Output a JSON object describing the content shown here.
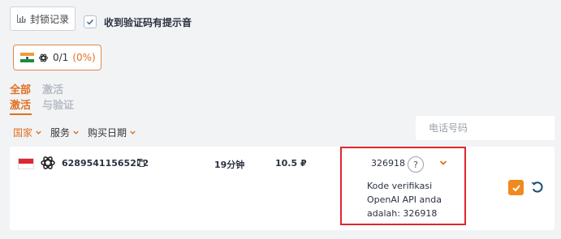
{
  "toolbar": {
    "block_records_label": "封锁记录",
    "notify_label": "收到验证码有提示音",
    "notify_checked": true
  },
  "country_pill": {
    "count": "0/1",
    "percent": "(0%)"
  },
  "tabs": [
    {
      "line1": "全部",
      "line2": "激活",
      "active": true
    },
    {
      "line1": "激活",
      "line2": "与验证",
      "active": false
    }
  ],
  "filters": [
    {
      "label": "国家",
      "active": true
    },
    {
      "label": "服务",
      "active": false
    },
    {
      "label": "购买日期",
      "active": false
    }
  ],
  "search": {
    "placeholder": "电话号码",
    "value": ""
  },
  "order": {
    "phone": "62895411565222",
    "duration": "19分钟",
    "price": "10.5 ₽",
    "code": "326918",
    "help": "?",
    "sms": "Kode verifikasi OpenAI API anda adalah: 326918"
  },
  "colors": {
    "accent": "#e07022",
    "checkbox": "#f0891e",
    "highlight": "#e0262f",
    "refresh": "#1f4f7a"
  }
}
